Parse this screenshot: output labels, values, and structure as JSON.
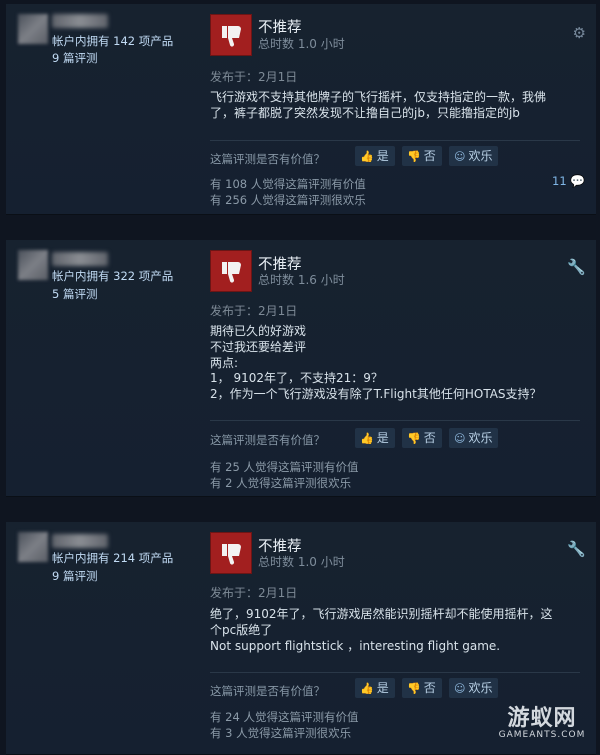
{
  "reviews": [
    {
      "owned": "帐户内拥有 142 项产品",
      "review_count": "9 篇评测",
      "verdict": "不推荐",
      "hours": "总时数 1.0 小时",
      "posted": "发布于：2月1日",
      "body_lines": [
        "飞行游戏不支持其他牌子的飞行摇杆，仅支持指定的一款，我佛",
        "了，裤子都脱了突然发现不让撸自己的jb，只能撸指定的jb"
      ],
      "helpful_question": "这篇评测是否有价值？",
      "yes_label": "是",
      "no_label": "否",
      "funny_label": "欢乐",
      "helpful_stat": "有 108 人觉得这篇评测有价值",
      "funny_stat": "有 256 人觉得这篇评测很欢乐",
      "comment_count": "11",
      "corner_icon": "steam-icon"
    },
    {
      "owned": "帐户内拥有 322 项产品",
      "review_count": "5 篇评测",
      "verdict": "不推荐",
      "hours": "总时数 1.6 小时",
      "posted": "发布于：2月1日",
      "body_lines": [
        "期待已久的好游戏",
        "不过我还要给差评",
        "两点:",
        "1， 9102年了，不支持21：9？",
        "2，作为一个飞行游戏没有除了T.Flight其他任何HOTAS支持？"
      ],
      "helpful_question": "这篇评测是否有价值？",
      "yes_label": "是",
      "no_label": "否",
      "funny_label": "欢乐",
      "helpful_stat": "有 25 人觉得这篇评测有价值",
      "funny_stat": "有 2 人觉得这篇评测很欢乐",
      "corner_icon": "key-icon"
    },
    {
      "owned": "帐户内拥有 214 项产品",
      "review_count": "9 篇评测",
      "verdict": "不推荐",
      "hours": "总时数 1.0 小时",
      "posted": "发布于：2月1日",
      "body_lines": [
        "绝了，9102年了，飞行游戏居然能识别摇杆却不能使用摇杆，这",
        "个pc版绝了",
        "Not support flightstick ，interesting flight game."
      ],
      "helpful_question": "这篇评测是否有价值？",
      "yes_label": "是",
      "no_label": "否",
      "funny_label": "欢乐",
      "helpful_stat": "有 24 人觉得这篇评测有价值",
      "funny_stat": "有 3 人觉得这篇评测很欢乐",
      "corner_icon": "key-icon"
    }
  ],
  "watermark": {
    "title": "游蚁网",
    "subtitle": "GAMEANTS.COM"
  },
  "colors": {
    "thumb_down_bg": "#a21f1f",
    "link_blue": "#7fb5e6",
    "panel_bg": "#17222f"
  }
}
